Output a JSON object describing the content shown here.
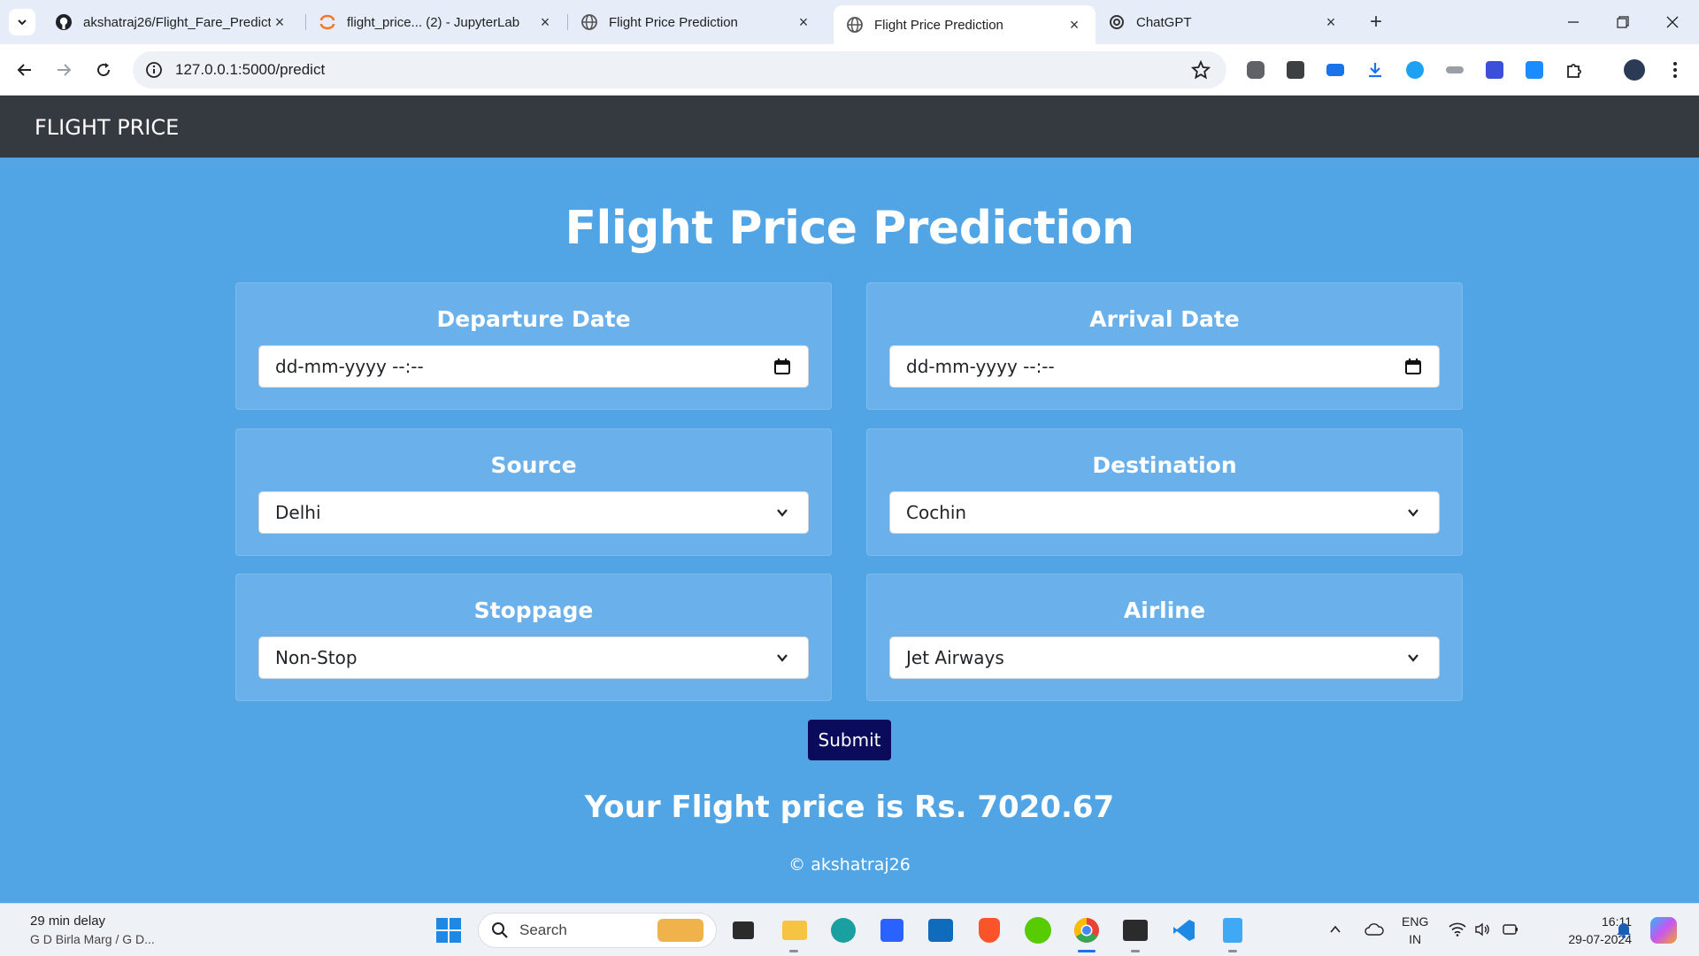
{
  "browser": {
    "tabs": [
      {
        "title": "akshatraj26/Flight_Fare_Predicti",
        "icon": "github-icon"
      },
      {
        "title": "flight_price... (2) - JupyterLab",
        "icon": "jupyter-icon"
      },
      {
        "title": "Flight Price Prediction",
        "icon": "globe-icon"
      },
      {
        "title": "Flight Price Prediction",
        "icon": "globe-icon",
        "active": true
      },
      {
        "title": "ChatGPT",
        "icon": "chatgpt-icon"
      }
    ],
    "url": "127.0.0.1:5000/predict"
  },
  "page": {
    "brand": "FLIGHT PRICE",
    "heading": "Flight Price Prediction",
    "fields": {
      "departure": {
        "label": "Departure Date",
        "value": "dd-mm-yyyy --:--"
      },
      "arrival": {
        "label": "Arrival Date",
        "value": "dd-mm-yyyy --:--"
      },
      "source": {
        "label": "Source",
        "value": "Delhi"
      },
      "destination": {
        "label": "Destination",
        "value": "Cochin"
      },
      "stoppage": {
        "label": "Stoppage",
        "value": "Non-Stop"
      },
      "airline": {
        "label": "Airline",
        "value": "Jet Airways"
      }
    },
    "submit_label": "Submit",
    "result": "Your Flight price is Rs. 7020.67",
    "footer": "© akshatraj26",
    "colors": {
      "background": "#51a5e5",
      "navbar": "#343a40",
      "card": "#6ab0ea",
      "submit": "#0b0b5c"
    }
  },
  "taskbar": {
    "weather_title": "29 min delay",
    "weather_sub": "G D Birla Marg / G D...",
    "search_label": "Search",
    "lang_top": "ENG",
    "lang_bottom": "IN",
    "time": "16:11",
    "date": "29-07-2024"
  }
}
